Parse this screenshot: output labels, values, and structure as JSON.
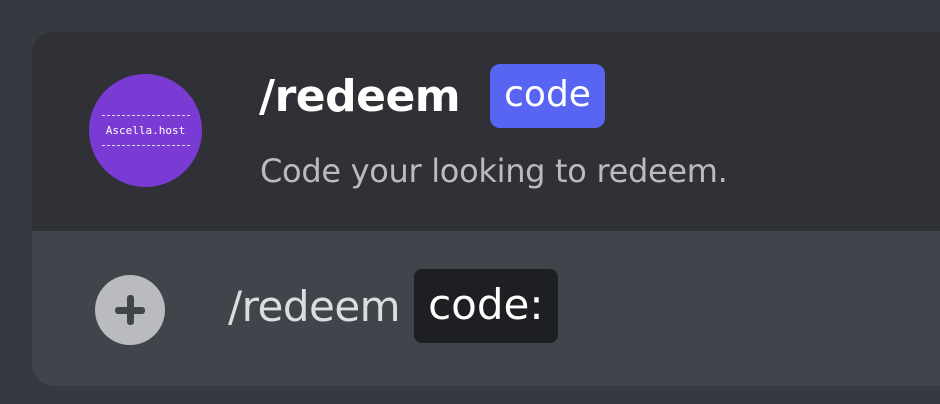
{
  "autocomplete": {
    "bot_avatar": {
      "label": "Ascella.host",
      "color": "#7a3bd4"
    },
    "command_name": "/redeem",
    "option_pill": "code",
    "description": "Code your looking to redeem."
  },
  "chat_input": {
    "plus_icon": "plus-circle-icon",
    "command_text": "/redeem",
    "option_chip": "code:"
  },
  "colors": {
    "background": "#36393f",
    "panel": "#2f3136",
    "input": "#40444b",
    "accent": "#5865f2",
    "chip": "#1e1f22"
  }
}
